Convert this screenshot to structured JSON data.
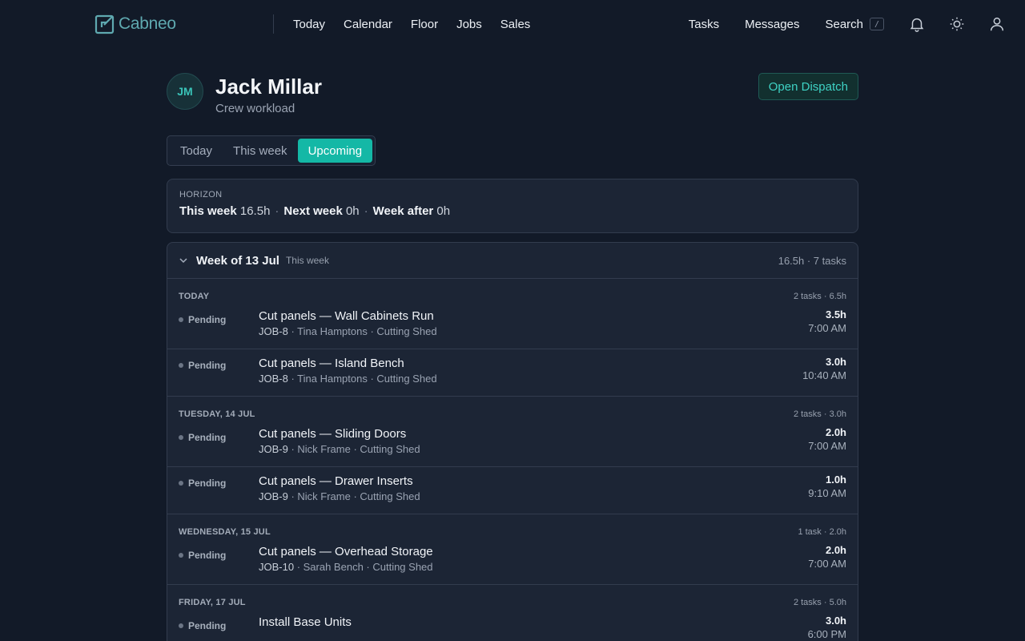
{
  "app": {
    "name": "Cabneo",
    "logo_icon": "cabneo-logo-icon"
  },
  "nav": {
    "main": [
      "Today",
      "Calendar",
      "Floor",
      "Jobs",
      "Sales"
    ],
    "tasks": "Tasks",
    "messages": "Messages",
    "search_label": "Search",
    "search_shortcut": "/"
  },
  "profile": {
    "initials": "JM",
    "name": "Jack Millar",
    "subtitle": "Crew workload",
    "dispatch_button": "Open Dispatch"
  },
  "tabs": [
    {
      "label": "Today",
      "active": false
    },
    {
      "label": "This week",
      "active": false
    },
    {
      "label": "Upcoming",
      "active": true
    }
  ],
  "horizon": {
    "label": "HORIZON",
    "items": [
      {
        "name": "This week",
        "value": "16.5h"
      },
      {
        "name": "Next week",
        "value": "0h"
      },
      {
        "name": "Week after",
        "value": "0h"
      }
    ]
  },
  "week": {
    "title": "Week of 13 Jul",
    "tag": "This week",
    "meta": "16.5h · 7 tasks",
    "days": [
      {
        "label": "TODAY",
        "meta": "2 tasks · 6.5h",
        "tasks": [
          {
            "status": "Pending",
            "title": "Cut panels — Wall Cabinets Run",
            "job": "JOB-8",
            "detail": " · Tina Hamptons · Cutting Shed",
            "hours": "3.5h",
            "time": "7:00 AM"
          },
          {
            "status": "Pending",
            "title": "Cut panels — Island Bench",
            "job": "JOB-8",
            "detail": " · Tina Hamptons · Cutting Shed",
            "hours": "3.0h",
            "time": "10:40 AM"
          }
        ]
      },
      {
        "label": "TUESDAY, 14 JUL",
        "meta": "2 tasks · 3.0h",
        "tasks": [
          {
            "status": "Pending",
            "title": "Cut panels — Sliding Doors",
            "job": "JOB-9",
            "detail": " · Nick Frame · Cutting Shed",
            "hours": "2.0h",
            "time": "7:00 AM"
          },
          {
            "status": "Pending",
            "title": "Cut panels — Drawer Inserts",
            "job": "JOB-9",
            "detail": " · Nick Frame · Cutting Shed",
            "hours": "1.0h",
            "time": "9:10 AM"
          }
        ]
      },
      {
        "label": "WEDNESDAY, 15 JUL",
        "meta": "1 task · 2.0h",
        "tasks": [
          {
            "status": "Pending",
            "title": "Cut panels — Overhead Storage",
            "job": "JOB-10",
            "detail": " · Sarah Bench · Cutting Shed",
            "hours": "2.0h",
            "time": "7:00 AM"
          }
        ]
      },
      {
        "label": "FRIDAY, 17 JUL",
        "meta": "2 tasks · 5.0h",
        "tasks": [
          {
            "status": "Pending",
            "title": "Install Base Units",
            "job": "",
            "detail": "",
            "hours": "3.0h",
            "time": "6:00 PM"
          }
        ]
      }
    ]
  },
  "colors": {
    "accent": "#14b8a6",
    "background": "#121a28",
    "card": "#1c2535"
  }
}
